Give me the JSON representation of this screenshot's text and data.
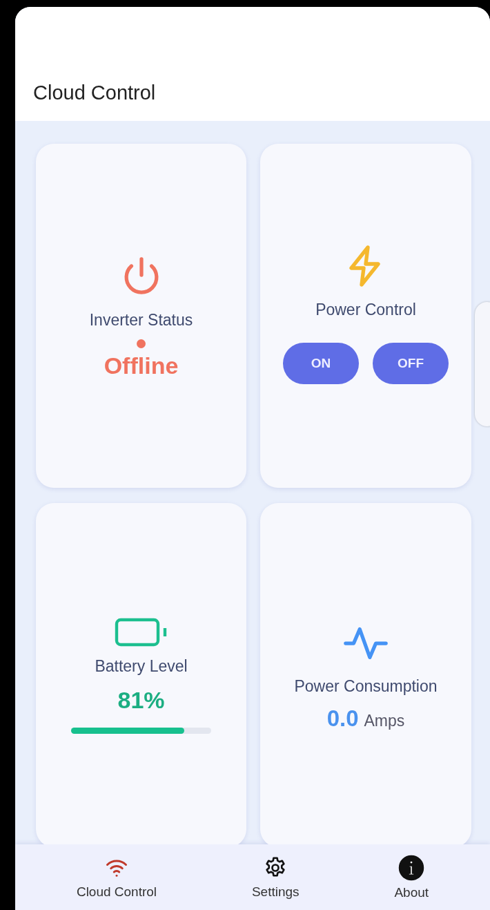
{
  "app_bar": {
    "title": "Cloud Control"
  },
  "cards": [
    {
      "kind": "status",
      "label": "Inverter Status",
      "value": "Offline",
      "color": "#f0735f"
    },
    {
      "kind": "control",
      "label": "Power Control",
      "buttons": [
        "ON",
        "OFF"
      ]
    },
    {
      "kind": "battery",
      "label": "Battery Level",
      "value": "81%",
      "level": 0.81
    },
    {
      "kind": "consumption",
      "label": "Power Consumption",
      "value": "0.0",
      "unit": "Amps"
    }
  ],
  "bottom_nav": [
    {
      "label": "Cloud Control",
      "kind": "wifi",
      "selected": true
    },
    {
      "label": "Settings",
      "kind": "gear",
      "selected": false
    },
    {
      "label": "About",
      "kind": "info",
      "selected": false
    }
  ]
}
